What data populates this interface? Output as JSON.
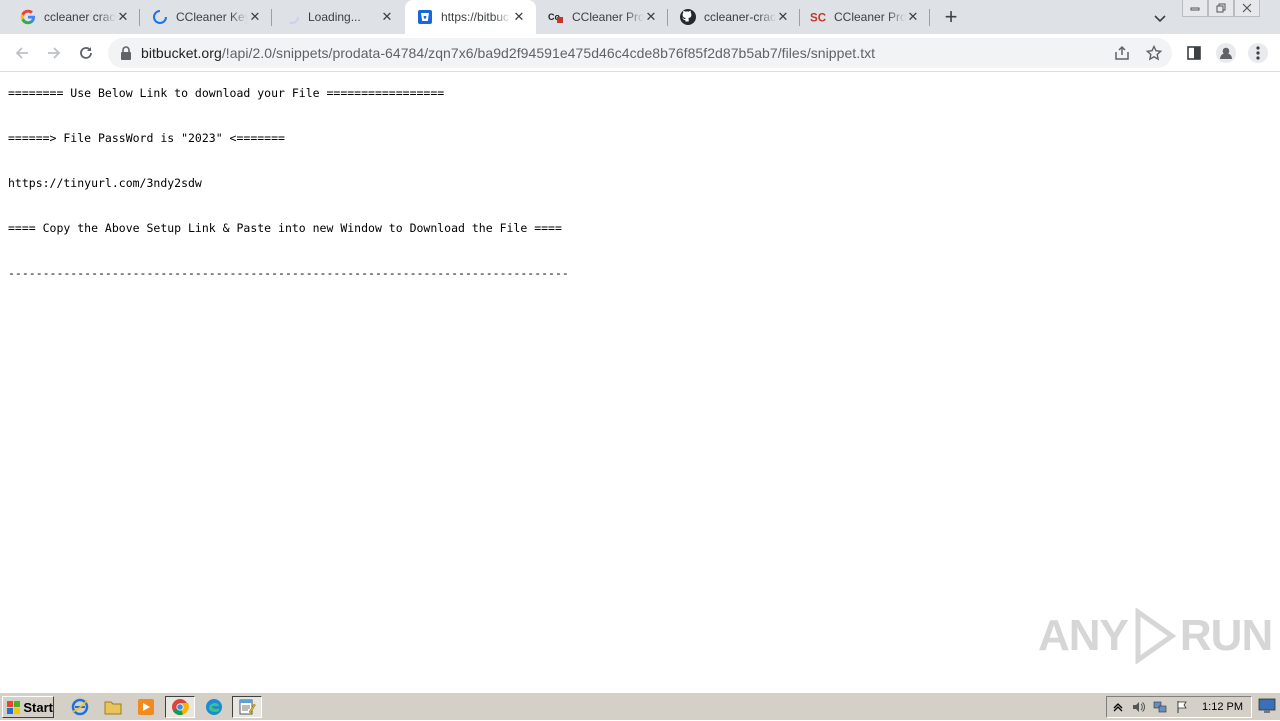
{
  "browser": {
    "tabs": [
      {
        "title": "ccleaner crack",
        "icon": "google-icon",
        "active": false
      },
      {
        "title": "CCleaner Key",
        "icon": "loading-spinner-icon",
        "active": false
      },
      {
        "title": "Loading...",
        "icon": "loading-spinner-icon",
        "active": false
      },
      {
        "title": "https://bitbucket",
        "icon": "bitbucket-icon",
        "active": true
      },
      {
        "title": "CCleaner Pro",
        "icon": "site-logo-icon",
        "active": false
      },
      {
        "title": "ccleaner-crack",
        "icon": "github-icon",
        "active": false
      },
      {
        "title": "CCleaner Prof",
        "icon": "sc-logo-icon",
        "active": false
      }
    ],
    "address": {
      "host": "bitbucket.org",
      "path": "/!api/2.0/snippets/prodata-64784/zqn7x6/ba9d2f94591e475d46c4cde8b76f85f2d87b5ab7/files/snippet.txt"
    }
  },
  "content": {
    "lines": [
      "======== Use Below Link to download your File =================",
      "======> File PassWord is \"2023\" <=======",
      "https://tinyurl.com/3ndy2sdw",
      "==== Copy the Above Setup Link & Paste into new Window to Download the File ====",
      "---------------------------------------------------------------------------------"
    ]
  },
  "watermark": {
    "left": "ANY",
    "right": "RUN"
  },
  "taskbar": {
    "start_label": "Start",
    "clock": "1:12 PM"
  }
}
